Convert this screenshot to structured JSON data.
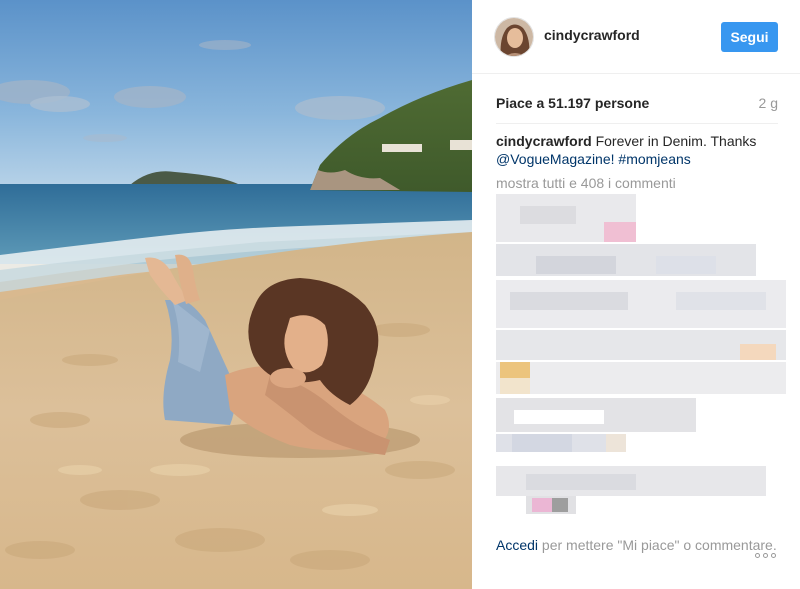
{
  "post": {
    "username": "cindycrawford",
    "follow_label": "Segui",
    "likes_text": "Piace a 51.197 persone",
    "time_ago": "2 g",
    "caption": {
      "author": "cindycrawford",
      "text_part1": " Forever in Denim. Thanks ",
      "mention": "@VogueMagazine!",
      "space": " ",
      "hashtag": "#momjeans"
    },
    "show_all_comments": "mostra tutti e 408 i commenti",
    "footer": {
      "login_link": "Accedi",
      "login_text": " per mettere \"Mi piace\" o commentare."
    }
  },
  "colors": {
    "accent": "#3897f0",
    "link": "#003569",
    "muted": "#999999"
  },
  "icons": {
    "more": "more-options-icon",
    "avatar": "profile-avatar"
  }
}
